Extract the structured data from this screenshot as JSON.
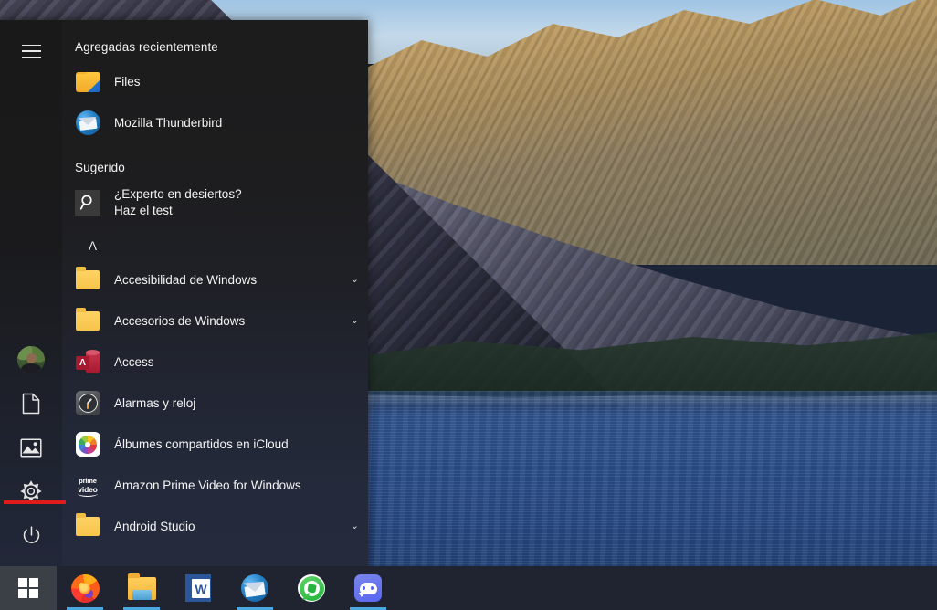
{
  "desktop": {
    "wallpaper_description": "Alpine mountain lake at sunset with sunlit rocky ridge"
  },
  "start_menu": {
    "hamburger_label": "Menú",
    "sections": {
      "recently_added_title": "Agregadas recientemente",
      "suggested_title": "Sugerido",
      "group_letter": "A"
    },
    "recently_added": [
      {
        "label": "Files",
        "icon": "files-app-icon"
      },
      {
        "label": "Mozilla Thunderbird",
        "icon": "thunderbird-icon"
      }
    ],
    "suggested": [
      {
        "line1": "¿Experto en desiertos?",
        "line2": "Haz el test",
        "icon": "search-tile-icon"
      }
    ],
    "apps": [
      {
        "label": "Accesibilidad de Windows",
        "icon": "folder-icon",
        "expandable": true,
        "chevron": "⌄"
      },
      {
        "label": "Accesorios de Windows",
        "icon": "folder-icon",
        "expandable": true,
        "chevron": "⌄"
      },
      {
        "label": "Access",
        "icon": "access-icon",
        "expandable": false,
        "icon_letter": "A"
      },
      {
        "label": "Alarmas y reloj",
        "icon": "alarms-clock-icon",
        "expandable": false
      },
      {
        "label": "Álbumes compartidos en iCloud",
        "icon": "icloud-photos-icon",
        "expandable": false
      },
      {
        "label": "Amazon Prime Video for Windows",
        "icon": "prime-video-icon",
        "expandable": false,
        "icon_text_top": "prime",
        "icon_text_bottom": "video"
      },
      {
        "label": "Android Studio",
        "icon": "folder-icon",
        "expandable": true,
        "chevron": "⌄"
      }
    ],
    "rail": [
      {
        "name": "user-account",
        "label": "Cuenta de usuario",
        "icon": "avatar"
      },
      {
        "name": "documents",
        "label": "Documentos",
        "icon": "document-icon"
      },
      {
        "name": "pictures",
        "label": "Imágenes",
        "icon": "pictures-icon"
      },
      {
        "name": "settings",
        "label": "Configuración",
        "icon": "gear-icon"
      },
      {
        "name": "power",
        "label": "Inicio/Apagado",
        "icon": "power-icon"
      }
    ],
    "annotation": {
      "color": "#e01b1b",
      "target": "settings"
    }
  },
  "taskbar": {
    "start_label": "Inicio",
    "items": [
      {
        "label": "Mozilla Firefox",
        "icon": "firefox-icon",
        "running": true
      },
      {
        "label": "Explorador de archivos",
        "icon": "file-explorer-icon",
        "running": true
      },
      {
        "label": "Word",
        "icon": "word-icon",
        "running": false,
        "icon_letter": "W"
      },
      {
        "label": "Mozilla Thunderbird",
        "icon": "thunderbird-icon",
        "running": true
      },
      {
        "label": "WhatsApp",
        "icon": "whatsapp-icon",
        "running": false
      },
      {
        "label": "Discord",
        "icon": "discord-icon",
        "running": true
      }
    ]
  },
  "colors": {
    "menu_top": "#1c1c1c",
    "menu_bottom": "#252b3d",
    "taskbar": "#1f2430",
    "accent_underline": "#4aa8e0",
    "annotation_red": "#e01b1b"
  }
}
